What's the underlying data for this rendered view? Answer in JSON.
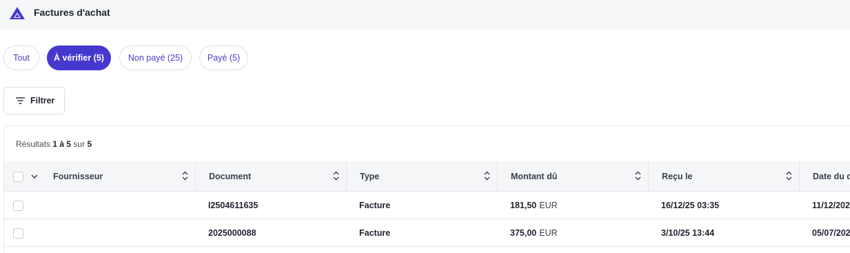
{
  "header": {
    "title": "Factures d'achat",
    "logo_icon": "triangle-logo-icon",
    "accent": "#4538cf"
  },
  "tabs": [
    {
      "label": "Tout",
      "active": false
    },
    {
      "label": "À vérifier (5)",
      "active": true
    },
    {
      "label": "Non payé (25)",
      "active": false
    },
    {
      "label": "Payé (5)",
      "active": false
    }
  ],
  "toolbar": {
    "filter_label": "Filtrer",
    "filter_icon": "filter-lines-icon"
  },
  "results": {
    "prefix": "Résultats",
    "range": "1 à 5",
    "of": "sur",
    "total": "5"
  },
  "table": {
    "columns": [
      "Fournisseur",
      "Document",
      "Type",
      "Montant dû",
      "Reçu le",
      "Date du d"
    ],
    "rows": [
      {
        "fournisseur": "",
        "document": "I2504611635",
        "type": "Facture",
        "montant": "181,50",
        "devise": "EUR",
        "recu": "16/12/25 03:35",
        "date": "11/12/202"
      },
      {
        "fournisseur": "",
        "document": "2025000088",
        "type": "Facture",
        "montant": "375,00",
        "devise": "EUR",
        "recu": "3/10/25 13:44",
        "date": "05/07/202"
      }
    ]
  }
}
